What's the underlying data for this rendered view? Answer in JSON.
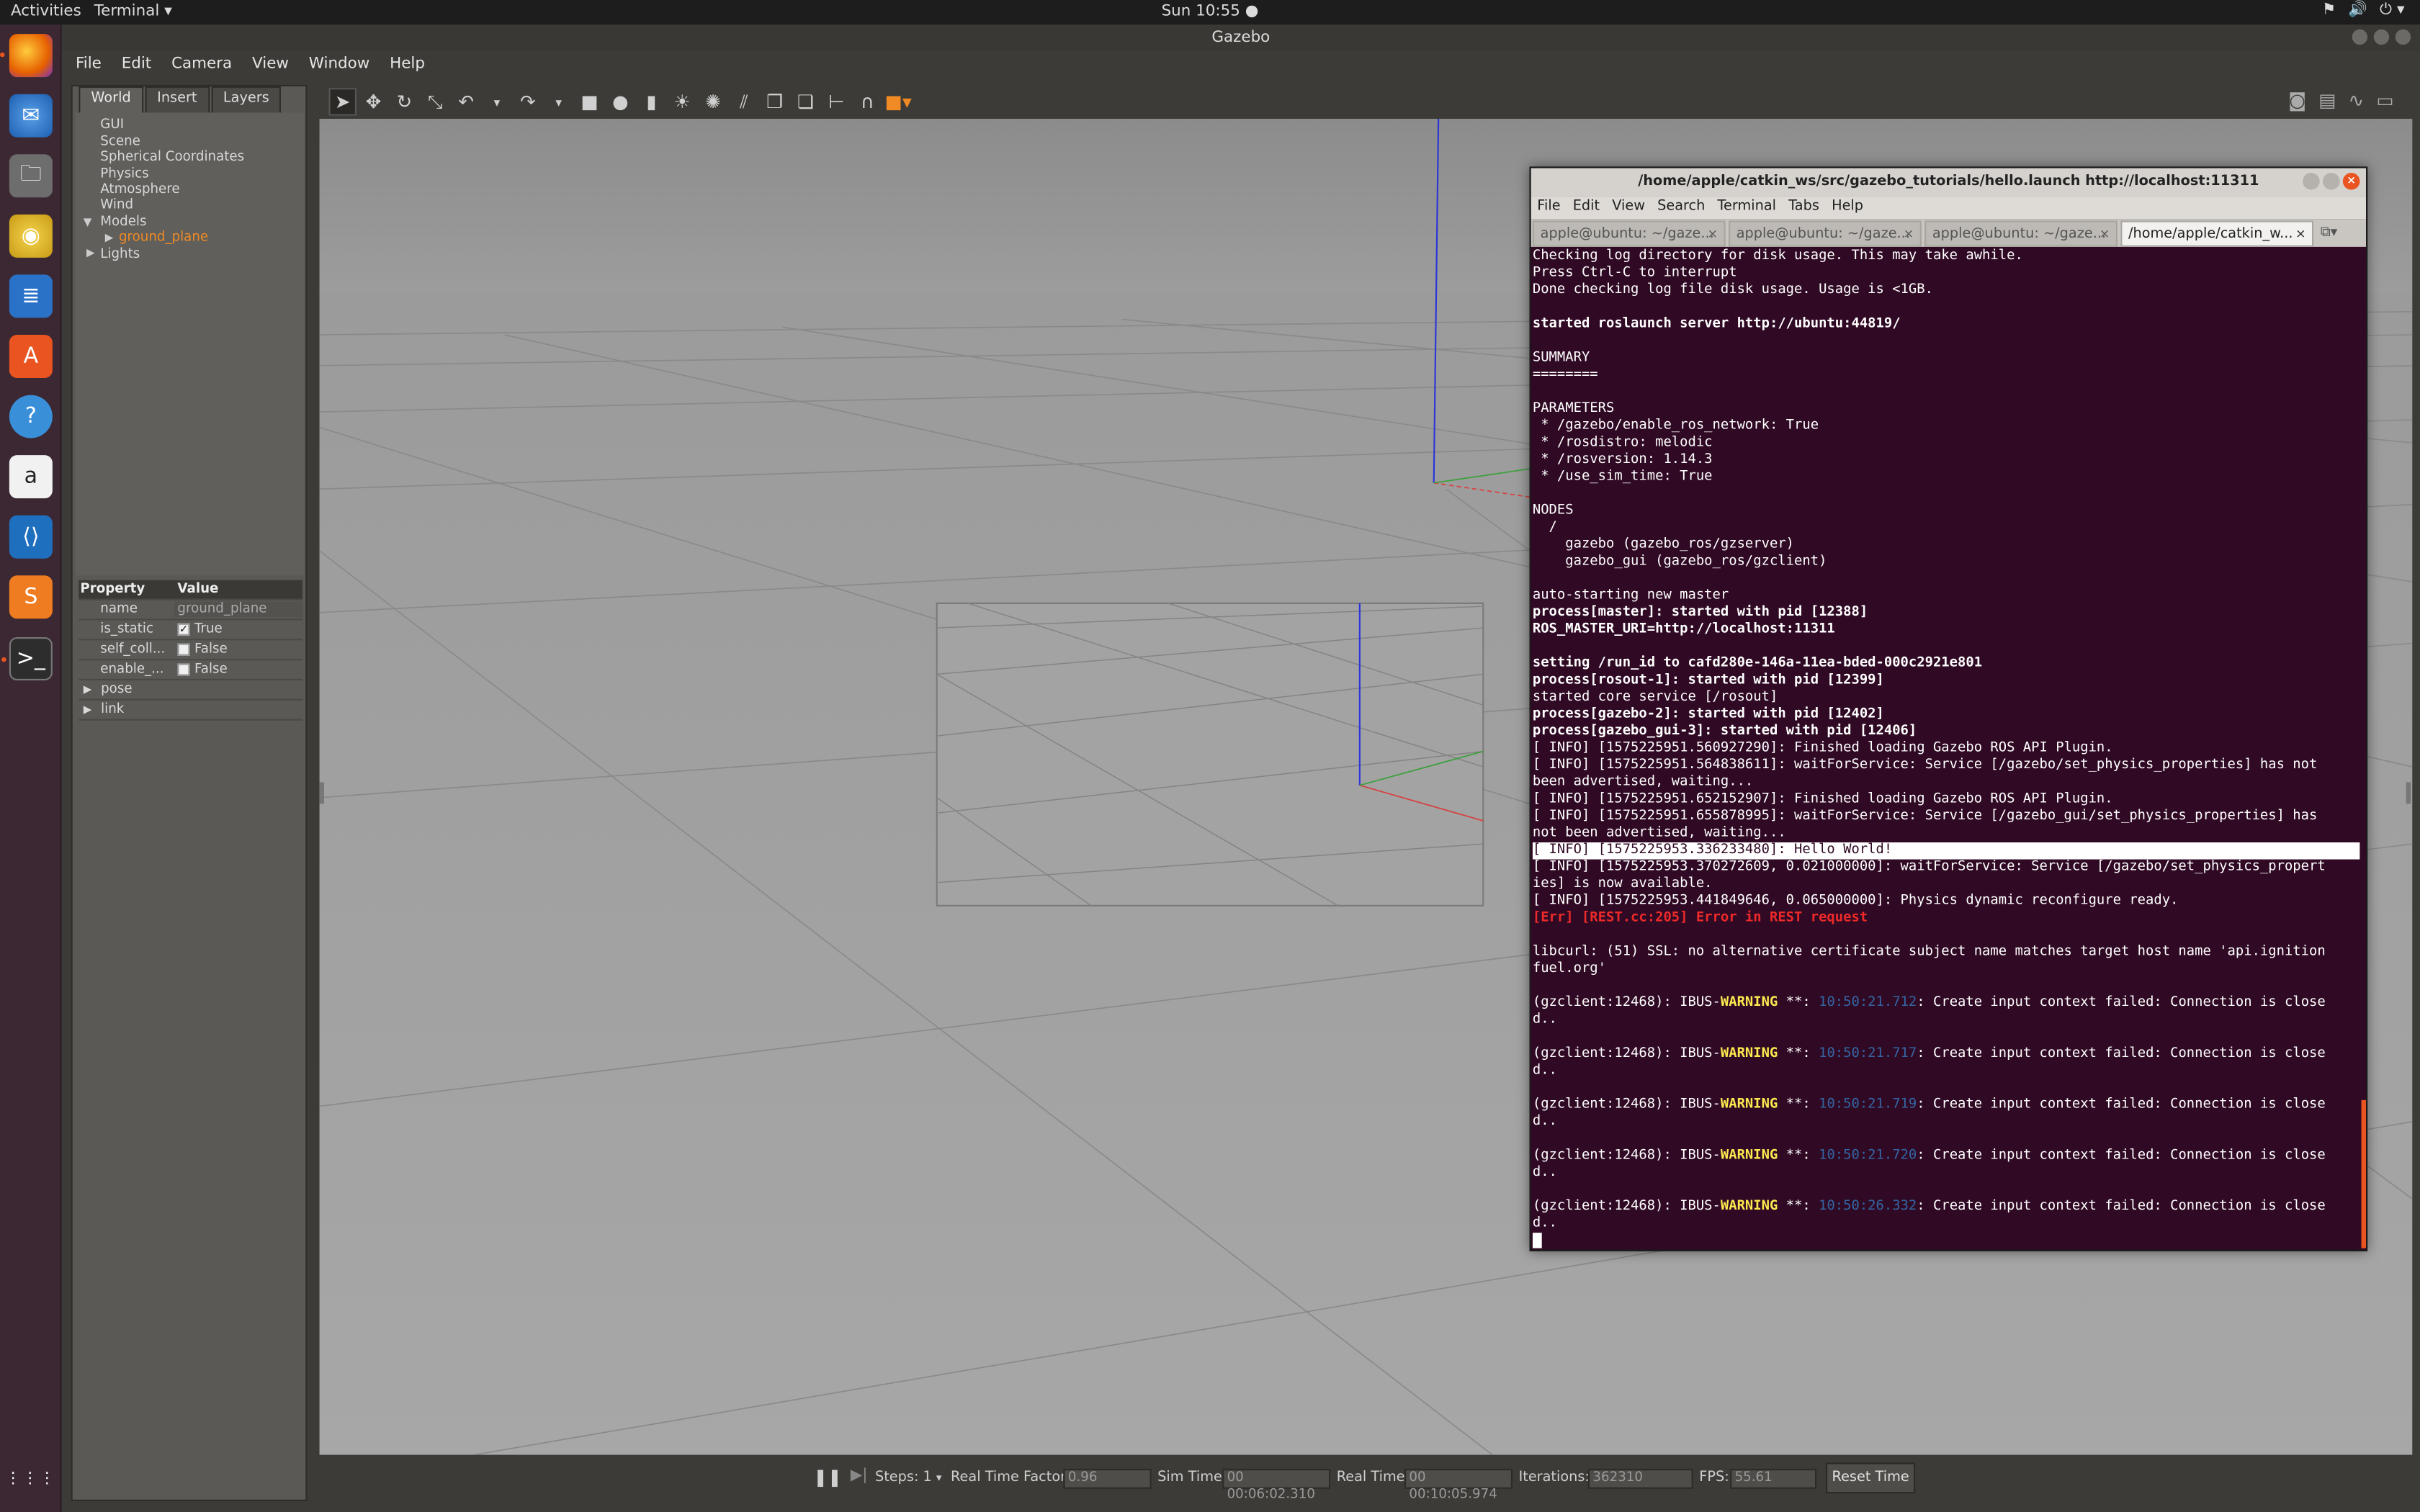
{
  "topbar": {
    "activities": "Activities",
    "app_menu": "Terminal ▾",
    "clock": "Sun 10:55 ●",
    "tray": [
      "⚑",
      "🔊",
      "⏻ ▾"
    ]
  },
  "launcher": {
    "items": [
      "firefox-icon",
      "thunderbird-icon",
      "files-icon",
      "rhythmbox-icon",
      "writer-icon",
      "software-icon",
      "help-icon",
      "amazon-icon",
      "vscode-icon",
      "sublime-icon",
      "terminal-icon"
    ],
    "apps_grid": "⋮⋮⋮"
  },
  "gazebo": {
    "title": "Gazebo",
    "menu": [
      "File",
      "Edit",
      "Camera",
      "View",
      "Window",
      "Help"
    ],
    "left_tabs": [
      "World",
      "Insert",
      "Layers"
    ],
    "tree": [
      "GUI",
      "Scene",
      "Spherical Coordinates",
      "Physics",
      "Atmosphere",
      "Wind",
      "Models",
      "ground_plane",
      "Lights"
    ],
    "properties": {
      "header_property": "Property",
      "header_value": "Value",
      "rows": [
        {
          "key": "name",
          "value": "ground_plane"
        },
        {
          "key": "is_static",
          "value": "True",
          "checked": true
        },
        {
          "key": "self_coll...",
          "value": "False",
          "checked": false
        },
        {
          "key": "enable_...",
          "value": "False",
          "checked": false
        }
      ],
      "groups": [
        "pose",
        "link"
      ]
    },
    "bottom": {
      "steps_label": "Steps:",
      "steps_value": "1",
      "rtf_label": "Real Time Factor:",
      "rtf_value": "0.96",
      "sim_label": "Sim Time:",
      "sim_value": "00 00:06:02.310",
      "real_label": "Real Time:",
      "real_value": "00 00:10:05.974",
      "iter_label": "Iterations:",
      "iter_value": "362310",
      "fps_label": "FPS:",
      "fps_value": "55.61",
      "reset": "Reset Time"
    }
  },
  "terminal": {
    "title": "/home/apple/catkin_ws/src/gazebo_tutorials/hello.launch http://localhost:11311",
    "menu": [
      "File",
      "Edit",
      "View",
      "Search",
      "Terminal",
      "Tabs",
      "Help"
    ],
    "tabs": [
      "apple@ubuntu: ~/gaze...",
      "apple@ubuntu: ~/gaze...",
      "apple@ubuntu: ~/gaze...",
      "/home/apple/catkin_w..."
    ],
    "lines": [
      {
        "t": "Checking log directory for disk usage. This may take awhile."
      },
      {
        "t": "Press Ctrl-C to interrupt"
      },
      {
        "t": "Done checking log file disk usage. Usage is <1GB."
      },
      {
        "t": ""
      },
      {
        "t": "started roslaunch server http://ubuntu:44819/",
        "s": "b"
      },
      {
        "t": ""
      },
      {
        "t": "SUMMARY"
      },
      {
        "t": "========"
      },
      {
        "t": ""
      },
      {
        "t": "PARAMETERS"
      },
      {
        "t": " * /gazebo/enable_ros_network: True"
      },
      {
        "t": " * /rosdistro: melodic"
      },
      {
        "t": " * /rosversion: 1.14.3"
      },
      {
        "t": " * /use_sim_time: True"
      },
      {
        "t": ""
      },
      {
        "t": "NODES"
      },
      {
        "t": "  /"
      },
      {
        "t": "    gazebo (gazebo_ros/gzserver)"
      },
      {
        "t": "    gazebo_gui (gazebo_ros/gzclient)"
      },
      {
        "t": ""
      },
      {
        "t": "auto-starting new master"
      },
      {
        "t": "process[master]: started with pid [12388]",
        "s": "b"
      },
      {
        "t": "ROS_MASTER_URI=http://localhost:11311",
        "s": "b"
      },
      {
        "t": ""
      },
      {
        "t": "setting /run_id to cafd280e-146a-11ea-bded-000c2921e801",
        "s": "b"
      },
      {
        "t": "process[rosout-1]: started with pid [12399]",
        "s": "b"
      },
      {
        "t": "started core service [/rosout]"
      },
      {
        "t": "process[gazebo-2]: started with pid [12402]",
        "s": "b"
      },
      {
        "t": "process[gazebo_gui-3]: started with pid [12406]",
        "s": "b"
      },
      {
        "t": "[ INFO] [1575225951.560927290]: Finished loading Gazebo ROS API Plugin."
      },
      {
        "t": "[ INFO] [1575225951.564838611]: waitForService: Service [/gazebo/set_physics_properties] has not"
      },
      {
        "t": "been advertised, waiting..."
      },
      {
        "t": "[ INFO] [1575225951.652152907]: Finished loading Gazebo ROS API Plugin."
      },
      {
        "t": "[ INFO] [1575225951.655878995]: waitForService: Service [/gazebo_gui/set_physics_properties] has"
      },
      {
        "t": "not been advertised, waiting..."
      },
      {
        "t": "[ INFO] [1575225953.336233480]: Hello World!",
        "s": "hl"
      },
      {
        "t": "[ INFO] [1575225953.370272609, 0.021000000]: waitForService: Service [/gazebo/set_physics_propert"
      },
      {
        "t": "ies] is now available."
      },
      {
        "t": "[ INFO] [1575225953.441849646, 0.065000000]: Physics dynamic reconfigure ready."
      },
      {
        "t": "[Err] [REST.cc:205] Error in REST request",
        "s": "err"
      },
      {
        "t": ""
      },
      {
        "t": "libcurl: (51) SSL: no alternative certificate subject name matches target host name 'api.ignition"
      },
      {
        "t": "fuel.org'"
      },
      {
        "t": ""
      },
      {
        "w": true,
        "pre": "(gzclient:12468): IBUS-",
        "warn": "WARNING",
        "mid": " **: ",
        "ts": "10:50:21.712",
        "post": ": Create input context failed: Connection is close"
      },
      {
        "t": "d.."
      },
      {
        "t": ""
      },
      {
        "w": true,
        "pre": "(gzclient:12468): IBUS-",
        "warn": "WARNING",
        "mid": " **: ",
        "ts": "10:50:21.717",
        "post": ": Create input context failed: Connection is close"
      },
      {
        "t": "d.."
      },
      {
        "t": ""
      },
      {
        "w": true,
        "pre": "(gzclient:12468): IBUS-",
        "warn": "WARNING",
        "mid": " **: ",
        "ts": "10:50:21.719",
        "post": ": Create input context failed: Connection is close"
      },
      {
        "t": "d.."
      },
      {
        "t": ""
      },
      {
        "w": true,
        "pre": "(gzclient:12468): IBUS-",
        "warn": "WARNING",
        "mid": " **: ",
        "ts": "10:50:21.720",
        "post": ": Create input context failed: Connection is close"
      },
      {
        "t": "d.."
      },
      {
        "t": ""
      },
      {
        "w": true,
        "pre": "(gzclient:12468): IBUS-",
        "warn": "WARNING",
        "mid": " **: ",
        "ts": "10:50:26.332",
        "post": ": Create input context failed: Connection is close"
      },
      {
        "t": "d.."
      },
      {
        "cursor": true
      }
    ]
  },
  "colors": {
    "terminal_bg": "#300a24",
    "ubuntu_orange": "#e95420",
    "viewport_bg": "#919191",
    "warning": "#fce94f",
    "timestamp": "#3465a4",
    "error": "#ef2929"
  }
}
